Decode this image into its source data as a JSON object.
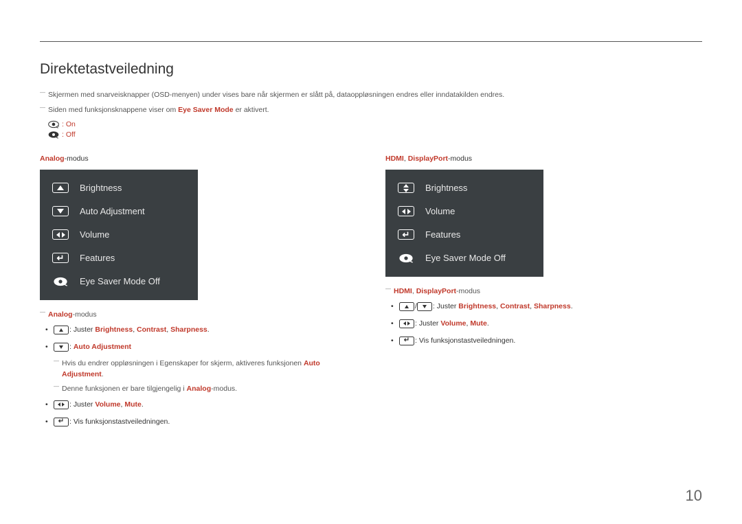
{
  "title": "Direktetastveiledning",
  "note1": "Skjermen med snarveisknapper (OSD-menyen) under vises bare når skjermen er slått på, dataoppløsningen endres eller inndatakilden endres.",
  "note2_pre": "Siden med funksjonsknappene viser om ",
  "note2_hl": "Eye Saver Mode",
  "note2_post": " er aktivert.",
  "eye_on": ": On",
  "eye_off": ": Off",
  "left": {
    "mode_hl": "Analog",
    "mode_suffix": "-modus",
    "osd": {
      "brightness": "Brightness",
      "auto_adj": "Auto Adjustment",
      "volume": "Volume",
      "features": "Features",
      "eye": "Eye Saver Mode Off"
    },
    "sub_mode_hl": "Analog",
    "sub_mode_suffix": "-modus",
    "b1_pre": ": Juster ",
    "b1_h1": "Brightness",
    "b1_c1": ", ",
    "b1_h2": "Contrast",
    "b1_c2": ", ",
    "b1_h3": "Sharpness",
    "b1_end": ".",
    "b2_pre": ": ",
    "b2_hl": "Auto Adjustment",
    "sd1_pre": "Hvis du endrer oppløsningen i Egenskaper for skjerm, aktiveres funksjonen ",
    "sd1_hl": "Auto Adjustment",
    "sd1_end": ".",
    "sd2_pre": "Denne funksjonen er bare tilgjengelig i ",
    "sd2_hl": "Analog",
    "sd2_end": "-modus.",
    "b3_pre": ": Juster ",
    "b3_h1": "Volume",
    "b3_c1": ", ",
    "b3_h2": "Mute",
    "b3_end": ".",
    "b4": ": Vis funksjonstastveiledningen."
  },
  "right": {
    "mode_h1": "HDMI",
    "mode_c": ", ",
    "mode_h2": "DisplayPort",
    "mode_suffix": "-modus",
    "osd": {
      "brightness": "Brightness",
      "volume": "Volume",
      "features": "Features",
      "eye": "Eye Saver Mode Off"
    },
    "sub_mode_h1": "HDMI",
    "sub_mode_c": ", ",
    "sub_mode_h2": "DisplayPort",
    "sub_mode_suffix": "-modus",
    "b1_pre": ": Juster ",
    "b1_h1": "Brightness",
    "b1_c1": ", ",
    "b1_h2": "Contrast",
    "b1_c2": ", ",
    "b1_h3": "Sharpness",
    "b1_end": ".",
    "b2_pre": ": Juster ",
    "b2_h1": "Volume",
    "b2_c1": ", ",
    "b2_h2": "Mute",
    "b2_end": ".",
    "b3": ": Vis funksjonstastveiledningen."
  },
  "page_number": "10"
}
